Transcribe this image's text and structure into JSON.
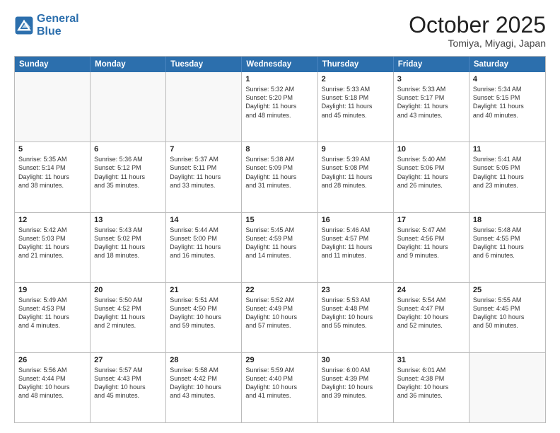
{
  "logo": {
    "line1": "General",
    "line2": "Blue"
  },
  "title": "October 2025",
  "subtitle": "Tomiya, Miyagi, Japan",
  "header": {
    "days": [
      "Sunday",
      "Monday",
      "Tuesday",
      "Wednesday",
      "Thursday",
      "Friday",
      "Saturday"
    ]
  },
  "rows": [
    [
      {
        "day": "",
        "text": ""
      },
      {
        "day": "",
        "text": ""
      },
      {
        "day": "",
        "text": ""
      },
      {
        "day": "1",
        "text": "Sunrise: 5:32 AM\nSunset: 5:20 PM\nDaylight: 11 hours\nand 48 minutes."
      },
      {
        "day": "2",
        "text": "Sunrise: 5:33 AM\nSunset: 5:18 PM\nDaylight: 11 hours\nand 45 minutes."
      },
      {
        "day": "3",
        "text": "Sunrise: 5:33 AM\nSunset: 5:17 PM\nDaylight: 11 hours\nand 43 minutes."
      },
      {
        "day": "4",
        "text": "Sunrise: 5:34 AM\nSunset: 5:15 PM\nDaylight: 11 hours\nand 40 minutes."
      }
    ],
    [
      {
        "day": "5",
        "text": "Sunrise: 5:35 AM\nSunset: 5:14 PM\nDaylight: 11 hours\nand 38 minutes."
      },
      {
        "day": "6",
        "text": "Sunrise: 5:36 AM\nSunset: 5:12 PM\nDaylight: 11 hours\nand 35 minutes."
      },
      {
        "day": "7",
        "text": "Sunrise: 5:37 AM\nSunset: 5:11 PM\nDaylight: 11 hours\nand 33 minutes."
      },
      {
        "day": "8",
        "text": "Sunrise: 5:38 AM\nSunset: 5:09 PM\nDaylight: 11 hours\nand 31 minutes."
      },
      {
        "day": "9",
        "text": "Sunrise: 5:39 AM\nSunset: 5:08 PM\nDaylight: 11 hours\nand 28 minutes."
      },
      {
        "day": "10",
        "text": "Sunrise: 5:40 AM\nSunset: 5:06 PM\nDaylight: 11 hours\nand 26 minutes."
      },
      {
        "day": "11",
        "text": "Sunrise: 5:41 AM\nSunset: 5:05 PM\nDaylight: 11 hours\nand 23 minutes."
      }
    ],
    [
      {
        "day": "12",
        "text": "Sunrise: 5:42 AM\nSunset: 5:03 PM\nDaylight: 11 hours\nand 21 minutes."
      },
      {
        "day": "13",
        "text": "Sunrise: 5:43 AM\nSunset: 5:02 PM\nDaylight: 11 hours\nand 18 minutes."
      },
      {
        "day": "14",
        "text": "Sunrise: 5:44 AM\nSunset: 5:00 PM\nDaylight: 11 hours\nand 16 minutes."
      },
      {
        "day": "15",
        "text": "Sunrise: 5:45 AM\nSunset: 4:59 PM\nDaylight: 11 hours\nand 14 minutes."
      },
      {
        "day": "16",
        "text": "Sunrise: 5:46 AM\nSunset: 4:57 PM\nDaylight: 11 hours\nand 11 minutes."
      },
      {
        "day": "17",
        "text": "Sunrise: 5:47 AM\nSunset: 4:56 PM\nDaylight: 11 hours\nand 9 minutes."
      },
      {
        "day": "18",
        "text": "Sunrise: 5:48 AM\nSunset: 4:55 PM\nDaylight: 11 hours\nand 6 minutes."
      }
    ],
    [
      {
        "day": "19",
        "text": "Sunrise: 5:49 AM\nSunset: 4:53 PM\nDaylight: 11 hours\nand 4 minutes."
      },
      {
        "day": "20",
        "text": "Sunrise: 5:50 AM\nSunset: 4:52 PM\nDaylight: 11 hours\nand 2 minutes."
      },
      {
        "day": "21",
        "text": "Sunrise: 5:51 AM\nSunset: 4:50 PM\nDaylight: 10 hours\nand 59 minutes."
      },
      {
        "day": "22",
        "text": "Sunrise: 5:52 AM\nSunset: 4:49 PM\nDaylight: 10 hours\nand 57 minutes."
      },
      {
        "day": "23",
        "text": "Sunrise: 5:53 AM\nSunset: 4:48 PM\nDaylight: 10 hours\nand 55 minutes."
      },
      {
        "day": "24",
        "text": "Sunrise: 5:54 AM\nSunset: 4:47 PM\nDaylight: 10 hours\nand 52 minutes."
      },
      {
        "day": "25",
        "text": "Sunrise: 5:55 AM\nSunset: 4:45 PM\nDaylight: 10 hours\nand 50 minutes."
      }
    ],
    [
      {
        "day": "26",
        "text": "Sunrise: 5:56 AM\nSunset: 4:44 PM\nDaylight: 10 hours\nand 48 minutes."
      },
      {
        "day": "27",
        "text": "Sunrise: 5:57 AM\nSunset: 4:43 PM\nDaylight: 10 hours\nand 45 minutes."
      },
      {
        "day": "28",
        "text": "Sunrise: 5:58 AM\nSunset: 4:42 PM\nDaylight: 10 hours\nand 43 minutes."
      },
      {
        "day": "29",
        "text": "Sunrise: 5:59 AM\nSunset: 4:40 PM\nDaylight: 10 hours\nand 41 minutes."
      },
      {
        "day": "30",
        "text": "Sunrise: 6:00 AM\nSunset: 4:39 PM\nDaylight: 10 hours\nand 39 minutes."
      },
      {
        "day": "31",
        "text": "Sunrise: 6:01 AM\nSunset: 4:38 PM\nDaylight: 10 hours\nand 36 minutes."
      },
      {
        "day": "",
        "text": ""
      }
    ]
  ]
}
